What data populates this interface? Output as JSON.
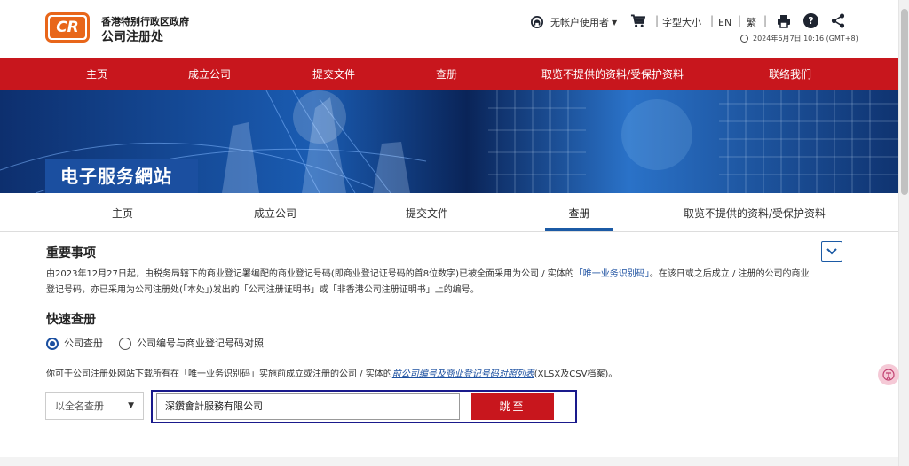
{
  "header": {
    "logo_text": "CR",
    "org_line1": "香港特别行政区政府",
    "org_line2": "公司注册处",
    "user_label": "无帐户使用者",
    "font_size_label": "字型大小",
    "lang_en": "EN",
    "lang_tc": "繁",
    "separator": "|",
    "datetime": "2024年6月7日 10:16 (GMT+8)"
  },
  "topnav": {
    "items": [
      "主页",
      "成立公司",
      "提交文件",
      "查册",
      "取览不提供的资料/受保护资料",
      "联络我们"
    ]
  },
  "banner": {
    "title": "电子服务網站"
  },
  "subnav": {
    "items": [
      "主页",
      "成立公司",
      "提交文件",
      "查册",
      "取览不提供的资料/受保护资料"
    ],
    "active": "查册"
  },
  "notice": {
    "heading": "重要事项",
    "text_before": "由2023年12月27日起，由税务局辖下的商业登记署编配的商业登记号码(即商业登记证号码的首8位数字)已被全面采用为公司 / 实体的",
    "link": "「唯一业务识别码」",
    "text_after": "。在该日或之后成立 / 注册的公司的商业登记号码，亦已采用为公司注册处(「本处」)发出的「公司注册证明书」或「非香港公司注册证明书」上的编号。"
  },
  "quick_search": {
    "heading": "快速查册",
    "options": [
      "公司查册",
      "公司编号与商业登记号码对照"
    ],
    "selected_option": "公司查册",
    "download_text_before": "你可于公司注册处网站下载所有在「唯一业务识别码」实施前成立或注册的公司 / 实体的",
    "download_link": "前公司编号及商业登记号码对照列表",
    "download_text_after": "(XLSX及CSV档案)。",
    "select_value": "以全名查册",
    "input_value": "深鑽會計服務有限公司",
    "go_button": "跳至"
  },
  "colors": {
    "brand_red": "#c8161d",
    "brand_blue": "#1b4fa0",
    "logo_orange": "#e8661a"
  }
}
